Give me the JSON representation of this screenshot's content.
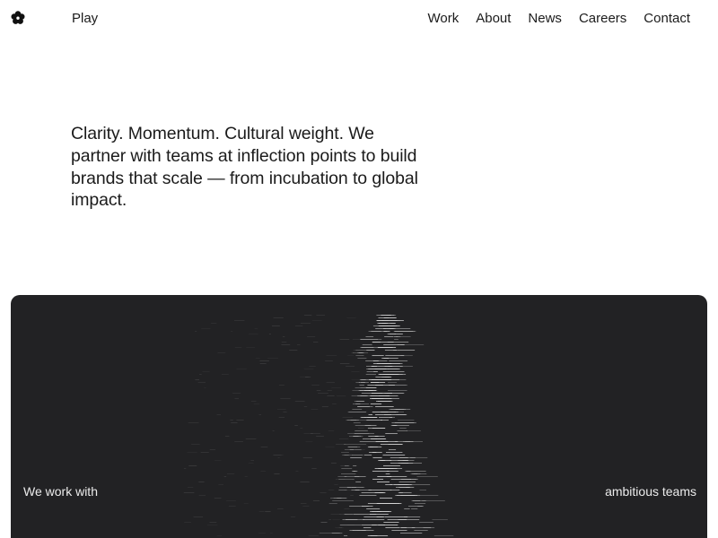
{
  "header": {
    "logo_icon": "flower-icon",
    "play_label": "Play",
    "nav": [
      {
        "label": "Work"
      },
      {
        "label": "About"
      },
      {
        "label": "News"
      },
      {
        "label": "Careers"
      },
      {
        "label": "Contact"
      }
    ]
  },
  "intro": {
    "text": "Clarity. Momentum. Cultural weight. We partner with teams at inflection points to build brands that scale — from incubation to global impact."
  },
  "hero": {
    "caption_left": "We work with",
    "caption_right": "ambitious teams",
    "background_color": "#222224",
    "visual": "dithered-figure-image"
  },
  "colors": {
    "text": "#1b1b1b",
    "background": "#ffffff",
    "hero_text": "#ececec"
  }
}
